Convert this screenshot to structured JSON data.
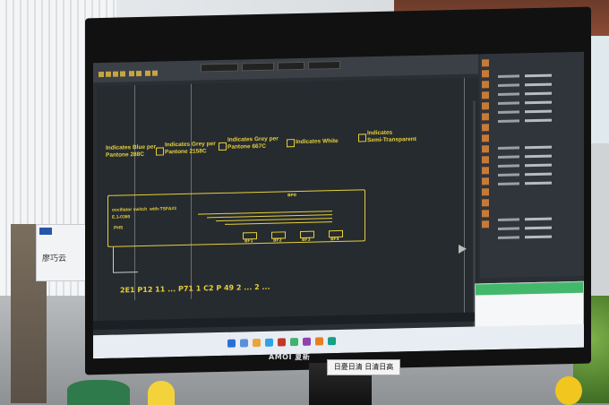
{
  "environment": {
    "nameplate_text": "廖巧云",
    "monitor_brand": "AMOI 夏新",
    "sticker_text": "日憂日清 日清日高"
  },
  "cad": {
    "legend": [
      {
        "label": "Indicates Blue per\nPantone 288C"
      },
      {
        "label": "Indicates Grey per\nPantone 2158C"
      },
      {
        "label": "Indicates Grey per\nPantone 667C"
      },
      {
        "label": "Indicates White"
      },
      {
        "label": "Indicates\nSemi-Transparent"
      }
    ],
    "pcb_label": "oscillator switch  with-TSFA#3\nE.1-0360",
    "pcb_ref": "PHS",
    "pad_labels": [
      "BF1",
      "BF2",
      "BF3",
      "BF4"
    ],
    "top_label": "BP0",
    "bottom_dimension_text": "2E1 P12 11 ... P71 1 C2 P 49 2 ... 2 ..."
  },
  "colors": {
    "cad_yellow": "#e6cf3c",
    "cad_bg": "#262b2f",
    "notif_green": "#42b86b"
  }
}
